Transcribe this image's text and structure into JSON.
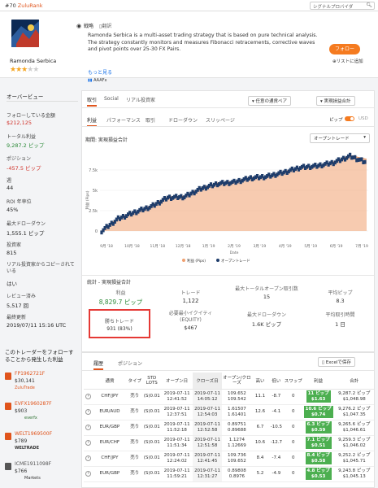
{
  "topbar": {
    "rank_num": "#70",
    "rank_label": "ZuluRank",
    "search_placeholder": "シグナルプロバイダ"
  },
  "profile": {
    "name": "Ramonda Serbica",
    "stars_filled": 3,
    "stars_total": 5,
    "strategy_label": "戦略",
    "translate_label": "翻訳",
    "description": "Ramonda Serbica is a multi-asset trading strategy that is based on pure technical analysis. The strategy constantly monitors and measures Fibonacci retracements, corrective waves and pivot points over 25-30 FX Pairs.",
    "more_label": "もっと見る",
    "broker": "AAAFx",
    "follow_button": "フォロー",
    "add_to_list": "リストに追加"
  },
  "overview": {
    "title": "オーバービュー",
    "stats": [
      {
        "label": "フォローしている金額",
        "value": "$212,125",
        "color": "red"
      },
      {
        "label": "トータル利益",
        "value": "9,287.2 ピップ",
        "color": "green"
      },
      {
        "label": "ポジション",
        "value": "-457.5 ピップ",
        "color": "red"
      },
      {
        "label": "週",
        "value": "44",
        "color": ""
      },
      {
        "label": "ROI 年率位",
        "value": "45%",
        "color": ""
      },
      {
        "label": "最大ドローダウン",
        "value": "1,555.1 ピップ",
        "color": ""
      },
      {
        "label": "投資家",
        "value": "815",
        "color": ""
      },
      {
        "label": "リアル投資家からコピーされている",
        "value": "はい",
        "color": ""
      },
      {
        "label": "レビュー済み",
        "value": "5,517 回",
        "color": ""
      },
      {
        "label": "最終更新",
        "value": "2019/07/11 15:16 UTC",
        "color": ""
      }
    ]
  },
  "copiers": {
    "title": "このトレーダーをフォローすることから発生した利益",
    "items": [
      {
        "name": "FP1962721F",
        "amount": "$30,141",
        "broker": "ZuluTrade",
        "color": "#e0541c"
      },
      {
        "name": "EVFX1960287F",
        "amount": "$903",
        "broker": "everfx",
        "color": "#e0541c"
      },
      {
        "name": "WELT1969500F",
        "amount": "$789",
        "broker": "WELTRADE",
        "color": "#e0541c"
      },
      {
        "name": "ICME1911098F",
        "amount": "$766",
        "broker": "Markets",
        "color": "#555"
      }
    ]
  },
  "main": {
    "tabs": [
      "取引",
      "Social",
      "リアル投資家"
    ],
    "currency_pair_filter": "任意の通貨ペア",
    "realized_filter": "実現損益合計",
    "subtabs": [
      "利益",
      "パフォーマンス",
      "取引",
      "ドローダウン",
      "スリッページ"
    ],
    "pips_label": "ピップ",
    "usd_label": "USD",
    "chart_heading": "期間: 実現損益合計",
    "open_trades_select": "オープントレード",
    "stats_heading": "統計 - 実現損益合計",
    "stats": [
      {
        "label": "利益",
        "value": "8,829.7 ピップ"
      },
      {
        "label": "トレード",
        "value": "1,122"
      },
      {
        "label": "最大トータルオープン取引数",
        "value": "15"
      },
      {
        "label": "平均ピップ",
        "value": "8.3"
      },
      {
        "label": "勝ちトレード",
        "value": "931 (83%)"
      },
      {
        "label": "必要最小イクイティ (EQUITY)",
        "value": "$467"
      },
      {
        "label": "最大ドローダウン",
        "value": "1.6K ピップ"
      },
      {
        "label": "平均取引時間",
        "value": "1 日"
      }
    ]
  },
  "chart_data": {
    "type": "area",
    "title": "",
    "ylabel": "利益 (Pips)",
    "xlabel": "Date",
    "y_ticks": [
      "0",
      "2.5k",
      "5k",
      "7.5k"
    ],
    "ylim": [
      -1000,
      10000
    ],
    "x_ticks": [
      "9月 '18",
      "10月 '18",
      "11月 '18",
      "12月 '18",
      "1月 '19",
      "2月 '19",
      "3月 '19",
      "4月 '19",
      "5月 '19",
      "6月 '19",
      "7月 '19"
    ],
    "current_label": "8,829.7",
    "series": [
      {
        "name": "利益 (Pips)",
        "color": "#f0a070",
        "values": [
          0,
          1600,
          2300,
          3100,
          4200,
          4300,
          5300,
          5900,
          6100,
          6600,
          6700,
          7300,
          7800,
          8000,
          8500,
          9300,
          8829
        ]
      },
      {
        "name": "オープントレード",
        "color": "#1f3d6b",
        "values": [
          0,
          1500,
          2300,
          3000,
          4100,
          4200,
          5200,
          5800,
          6000,
          6500,
          6700,
          7200,
          7800,
          8000,
          8400,
          9200,
          8400
        ]
      }
    ],
    "legend": [
      "利益 (Pips)",
      "オープントレード"
    ]
  },
  "history": {
    "tabs": [
      "履歴",
      "ポジション"
    ],
    "excel_label": "Excelで保存",
    "columns": [
      "",
      "通貨",
      "タイプ",
      "STD LOTS",
      "オープン日",
      "クローズ日",
      "オープン/クローズ",
      "高い",
      "低い",
      "スワップ",
      "利益",
      "合計"
    ],
    "rows": [
      {
        "pair": "CHF/JPY",
        "type": "売り",
        "lots": "(S)0.01",
        "open": "2019-07-11 12:41:52",
        "close": "2019-07-11 14:05:12",
        "oc": "109.652 109.542",
        "high": "11.1",
        "low": "-8.7",
        "swap": "0",
        "pips": "11 ピップ",
        "usd": "$1.63",
        "total": "9,287.2 ピップ $1,048.98"
      },
      {
        "pair": "EUR/AUD",
        "type": "売り",
        "lots": "(S)0.01",
        "open": "2019-07-11 12:37:51",
        "close": "2019-07-11 12:54:03",
        "oc": "1.61507 1.61401",
        "high": "12.6",
        "low": "-4.1",
        "swap": "0",
        "pips": "10.6 ピップ",
        "usd": "$0.74",
        "total": "9,276.2 ピップ $1,047.35"
      },
      {
        "pair": "EUR/GBP",
        "type": "売り",
        "lots": "(S)0.01",
        "open": "2019-07-11 11:52:18",
        "close": "2019-07-11 12:52:58",
        "oc": "0.89751 0.89688",
        "high": "6.7",
        "low": "-10.5",
        "swap": "0",
        "pips": "6.3 ピップ",
        "usd": "$0.59",
        "total": "9,265.6 ピップ $1,046.61"
      },
      {
        "pair": "EUR/CHF",
        "type": "売り",
        "lots": "(S)0.01",
        "open": "2019-07-11 11:51:34",
        "close": "2019-07-11 12:51:58",
        "oc": "1.1274 1.12669",
        "high": "10.6",
        "low": "-12.7",
        "swap": "0",
        "pips": "7.1 ピップ",
        "usd": "$0.51",
        "total": "9,259.3 ピップ $1,046.02"
      },
      {
        "pair": "CHF/JPY",
        "type": "売り",
        "lots": "(S)0.01",
        "open": "2019-07-11 12:24:02",
        "close": "2019-07-11 12:41:45",
        "oc": "109.736 109.652",
        "high": "8.4",
        "low": "-7.4",
        "swap": "0",
        "pips": "8.4 ピップ",
        "usd": "$0.58",
        "total": "9,252.2 ピップ $1,045.71"
      },
      {
        "pair": "EUR/GBP",
        "type": "売り",
        "lots": "(S)0.01",
        "open": "2019-07-11 11:59:21",
        "close": "2019-07-11 12:31:27",
        "oc": "0.89808 0.8976",
        "high": "5.2",
        "low": "-4.9",
        "swap": "0",
        "pips": "4.8 ピップ",
        "usd": "$0.53",
        "total": "9,243.8 ピップ $1,045.13"
      }
    ]
  }
}
